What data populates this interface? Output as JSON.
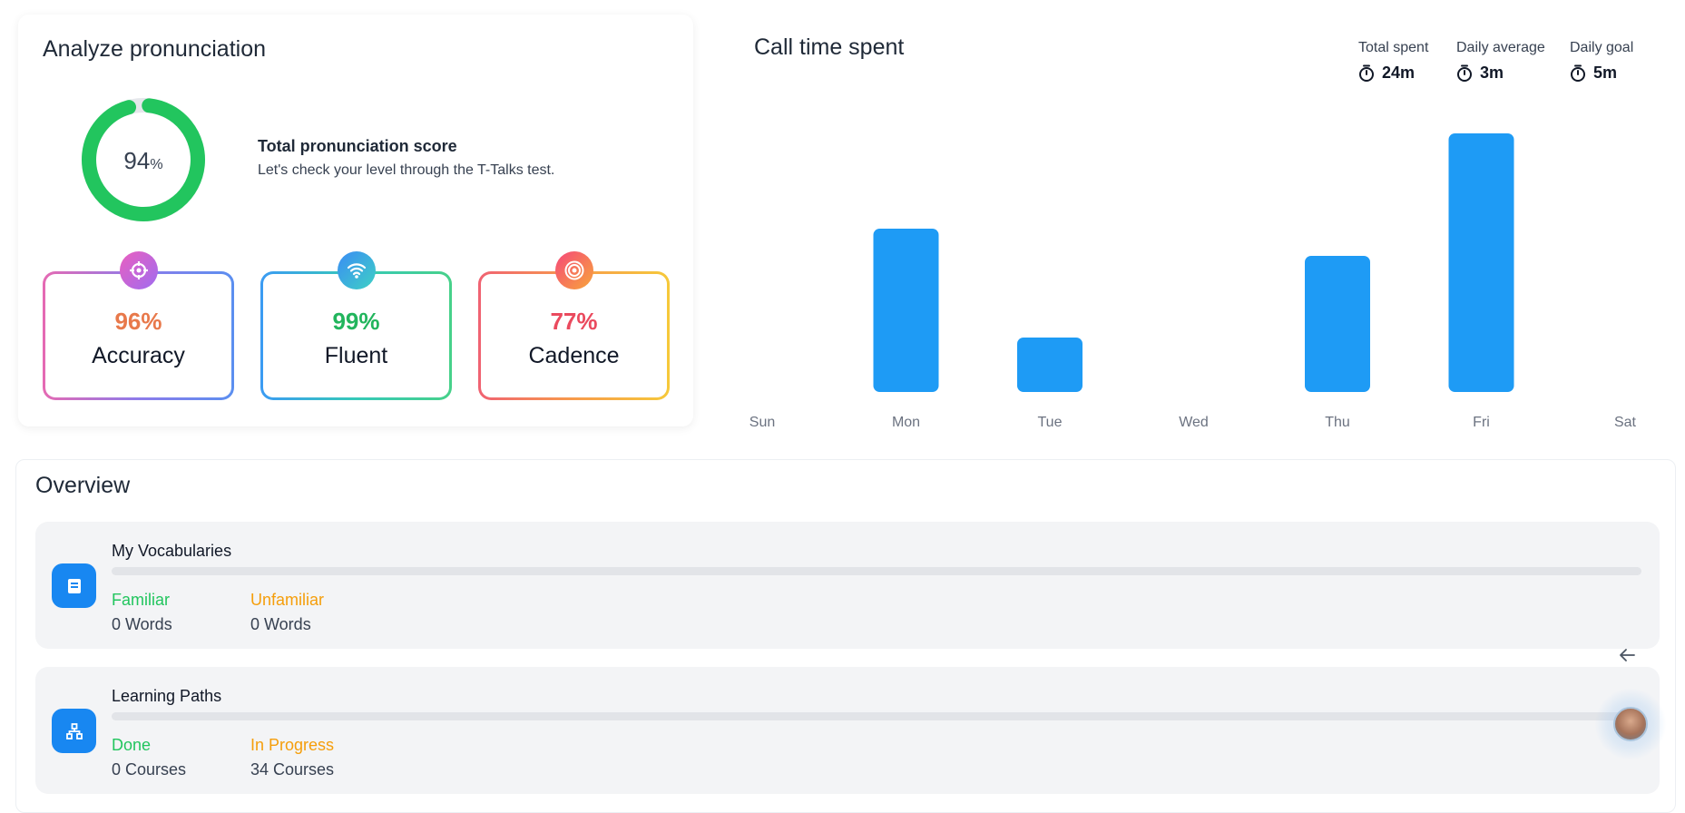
{
  "pronunciation": {
    "title": "Analyze pronunciation",
    "score_value": "94",
    "score_unit": "%",
    "score_fraction": 0.94,
    "score_title": "Total pronunciation score",
    "score_subtitle": "Let's check your level through the T-Talks test.",
    "metrics": [
      {
        "pct": "96%",
        "label": "Accuracy",
        "color": "#e8794b",
        "icon": "crosshair-icon"
      },
      {
        "pct": "99%",
        "label": "Fluent",
        "color": "#22b55d",
        "icon": "wifi-icon"
      },
      {
        "pct": "77%",
        "label": "Cadence",
        "color": "#ea4a5e",
        "icon": "target-icon"
      }
    ]
  },
  "call_time": {
    "title": "Call time spent",
    "stats": [
      {
        "label": "Total spent",
        "value": "24m",
        "icon": "timer-icon"
      },
      {
        "label": "Daily average",
        "value": "3m",
        "icon": "timer-icon"
      },
      {
        "label": "Daily goal",
        "value": "5m",
        "icon": "timer-icon"
      }
    ]
  },
  "chart_data": {
    "type": "bar",
    "categories": [
      "Sun",
      "Mon",
      "Tue",
      "Wed",
      "Thu",
      "Fri",
      "Sat"
    ],
    "values": [
      0,
      6,
      2,
      0,
      5,
      9.5,
      0
    ],
    "ylim": [
      0,
      10
    ],
    "bar_color": "#1e9bf5",
    "grid": false,
    "title": "",
    "xlabel": "",
    "ylabel": ""
  },
  "overview": {
    "title": "Overview",
    "rows": [
      {
        "name": "My Vocabularies",
        "icon": "book-icon",
        "left_key": "Familiar",
        "left_val": "0 Words",
        "right_key": "Unfamiliar",
        "right_val": "0 Words"
      },
      {
        "name": "Learning Paths",
        "icon": "hierarchy-icon",
        "left_key": "Done",
        "left_val": "0 Courses",
        "right_key": "In Progress",
        "right_val": "34 Courses"
      }
    ]
  },
  "colors": {
    "accent": "#1887f1",
    "green": "#22c55e",
    "orange": "#f59e0b"
  }
}
